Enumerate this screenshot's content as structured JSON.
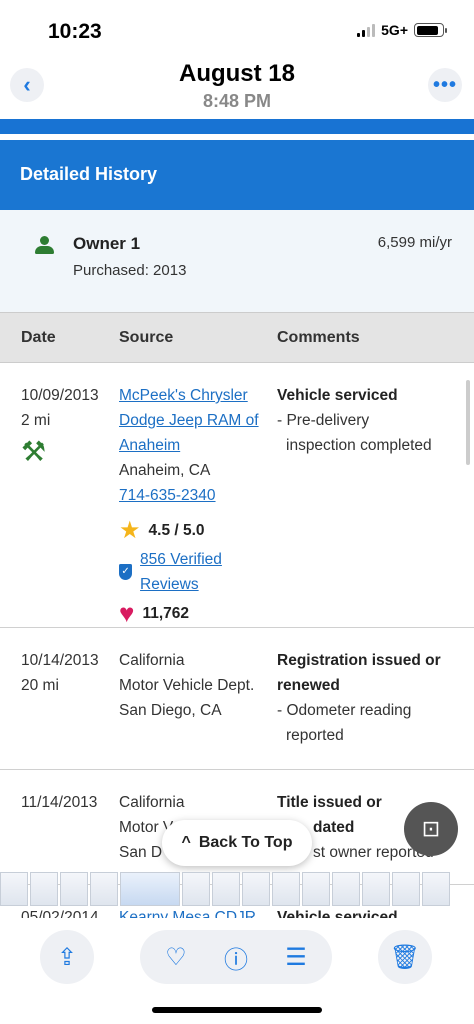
{
  "status_bar": {
    "time": "10:23",
    "network": "5G+"
  },
  "header": {
    "title": "August 18",
    "subtitle": "8:48 PM"
  },
  "section": {
    "title": "Detailed History"
  },
  "owner": {
    "name": "Owner 1",
    "purchased": "Purchased: 2013",
    "mileage": "6,599 mi/yr"
  },
  "table": {
    "headers": {
      "date": "Date",
      "source": "Source",
      "comments": "Comments"
    },
    "rows": [
      {
        "date": "10/09/2013",
        "mileage": "2 mi",
        "source_lines": [
          "McPeek's Chrysler",
          "Dodge Jeep RAM of",
          "Anaheim"
        ],
        "location": "Anaheim, CA",
        "phone": "714-635-2340",
        "rating": "4.5 / 5.0",
        "reviews": "856 Verified Reviews",
        "favorites": "11,762",
        "comment_title": "Vehicle serviced",
        "comment_lines": [
          "- Pre-delivery",
          "inspection completed"
        ]
      },
      {
        "date": "10/14/2013",
        "mileage": "20 mi",
        "source_lines": [
          "California",
          "Motor Vehicle Dept.",
          "San Diego, CA"
        ],
        "comment_title_lines": [
          "Registration issued or",
          "renewed"
        ],
        "comment_lines": [
          "- Odometer reading",
          "reported"
        ]
      },
      {
        "date": "11/14/2013",
        "source_lines": [
          "California",
          "Motor V",
          "San D"
        ],
        "comment_title_lines": [
          "Title issued or",
          "dated"
        ],
        "comment_lines": [
          "st owner reported"
        ]
      },
      {
        "date": "05/02/2014",
        "source_lines": [
          "Kearny Mesa CDJR"
        ],
        "comment_title": "Vehicle serviced"
      }
    ]
  },
  "overlay": {
    "back_to_top": "Back To Top"
  },
  "toolbar": {
    "share_icon": "share-icon",
    "favorite_icon": "heart-icon",
    "info_icon": "info-icon",
    "adjust_icon": "sliders-icon",
    "delete_icon": "trash-icon"
  },
  "colors": {
    "accent": "#1a76d2",
    "link": "#1c6fc4",
    "ios_blue": "#1f7ae0",
    "star": "#f5b51b",
    "heart": "#d81b60",
    "green": "#2e7d32"
  }
}
